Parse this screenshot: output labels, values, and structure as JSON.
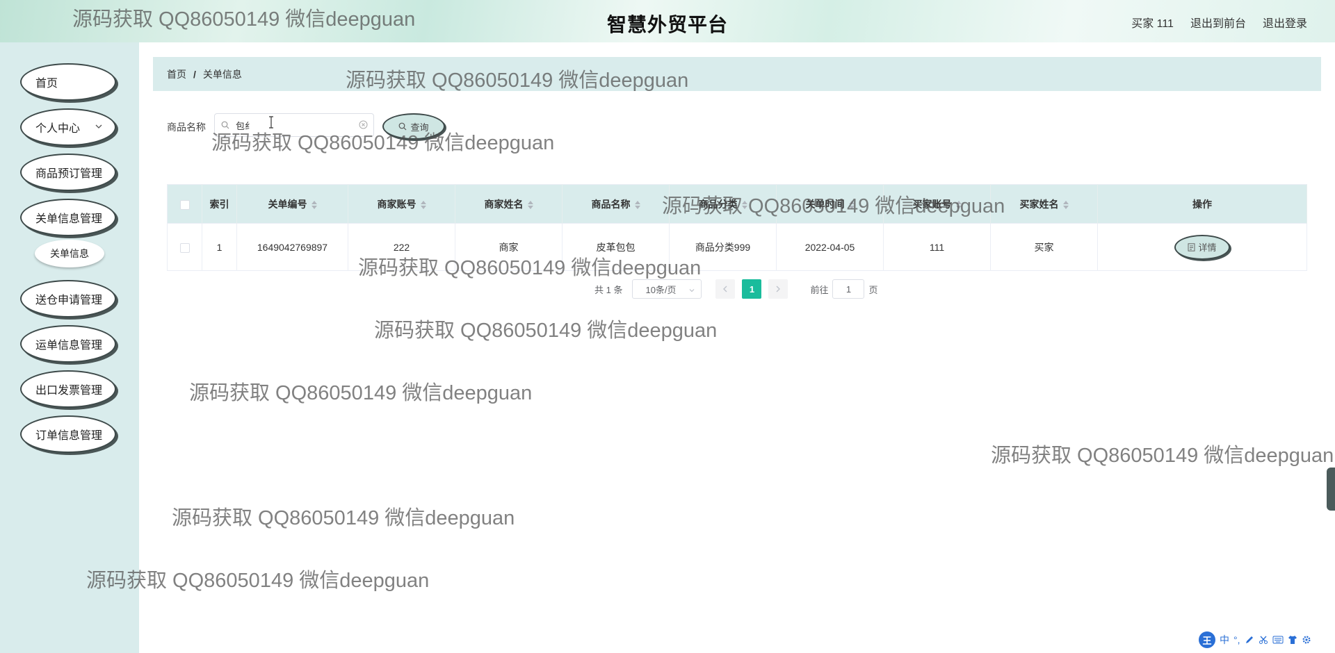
{
  "header": {
    "title": "智慧外贸平台",
    "user": "买家 111",
    "front_link": "退出到前台",
    "logout_link": "退出登录"
  },
  "sidebar": {
    "items": [
      {
        "label": "首页"
      },
      {
        "label": "个人中心"
      },
      {
        "label": "商品预订管理"
      },
      {
        "label": "关单信息管理"
      },
      {
        "label": "送仓申请管理"
      },
      {
        "label": "运单信息管理"
      },
      {
        "label": "出口发票管理"
      },
      {
        "label": "订单信息管理"
      }
    ],
    "sub_item": "关单信息"
  },
  "breadcrumb": {
    "home": "首页",
    "separator": "/",
    "current": "关单信息"
  },
  "search": {
    "label": "商品名称",
    "value": "包纟",
    "button": "查询"
  },
  "table": {
    "headers": [
      "索引",
      "关单编号",
      "商家账号",
      "商家姓名",
      "商品名称",
      "商品分类",
      "关单时间",
      "买家账号",
      "买家姓名",
      "操作"
    ],
    "rows": [
      {
        "index": "1",
        "order_no": "1649042769897",
        "merchant_account": "222",
        "merchant_name": "商家",
        "product_name": "皮革包包",
        "category": "商品分类999",
        "time": "2022-04-05",
        "buyer_account": "111",
        "buyer_name": "买家",
        "action": "详情"
      }
    ]
  },
  "pagination": {
    "total": "共 1 条",
    "page_size": "10条/页",
    "current_page": "1",
    "goto_label": "前往",
    "goto_value": "1",
    "page_unit": "页"
  },
  "watermark": "源码获取 QQ86050149 微信deepguan",
  "ime": {
    "logo": "王",
    "lang": "中"
  },
  "colors": {
    "accent": "#1abc9c",
    "panel": "#d9ecec",
    "button_bg": "#cfe6e3"
  }
}
